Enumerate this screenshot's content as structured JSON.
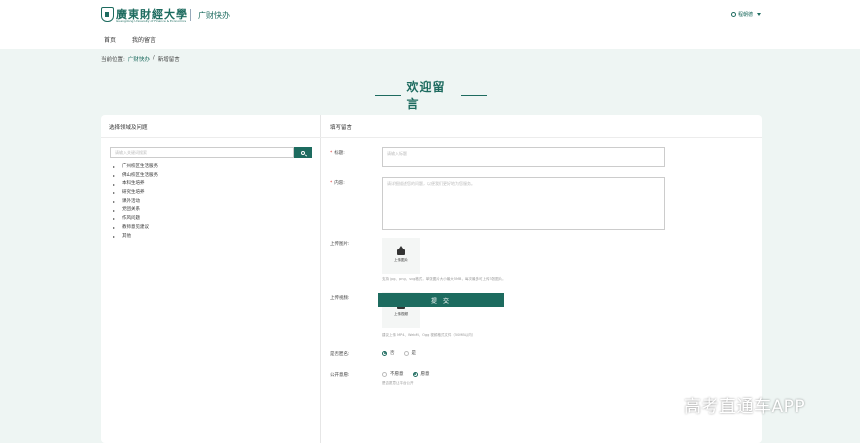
{
  "header": {
    "logo_cn": "廣東財經大學",
    "logo_en": "Guangdong University of Finance & Economics",
    "app_name": "广财快办",
    "user_name": "程朝德"
  },
  "nav": {
    "home": "首页",
    "my_messages": "我的留言"
  },
  "breadcrumb": {
    "prefix": "当前位置:",
    "link": "广财快办",
    "sep": "/",
    "current": "新增留言"
  },
  "title": "欢迎留言",
  "left_panel": {
    "heading": "选择领域及问题",
    "search_placeholder": "请输入关键词搜索",
    "items": [
      {
        "label": "广州校区生活服务"
      },
      {
        "label": "佛山校区生活服务"
      },
      {
        "label": "本科生培养"
      },
      {
        "label": "研究生培养"
      },
      {
        "label": "课外活动"
      },
      {
        "label": "党团关系"
      },
      {
        "label": "作风问题"
      },
      {
        "label": "教师意见建议"
      },
      {
        "label": "其他"
      }
    ]
  },
  "form": {
    "heading": "填写留言",
    "title_label": "标题:",
    "title_placeholder": "请输入标题",
    "content_label": "内容:",
    "content_placeholder": "请详细描述您的问题，以便我们更好地为您服务。",
    "image_label": "上传图片:",
    "image_button": "上传图片",
    "image_hint": "支持 jpg、png、svg格式，单张图片大小最大5MB，每次最多可上传3张图片。",
    "video_label": "上传视频:",
    "video_button": "上传视频",
    "video_hint": "建议上传 MP4、WebM、Ogg 视频格式文件（50MB以内）",
    "anonymous_label": "是否匿名:",
    "anonymous_no": "否",
    "anonymous_yes": "是",
    "public_label": "公开意愿:",
    "public_no": "不愿意",
    "public_yes": "愿意",
    "public_hint": "是否愿意让平台公开",
    "submit": "提 交"
  },
  "watermark": "高考直通车APP",
  "colors": {
    "primary": "#1d6b5f",
    "background": "#eef5f3",
    "required": "#dd3333"
  }
}
